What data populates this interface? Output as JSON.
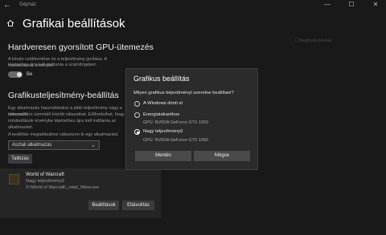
{
  "app": {
    "name": "Gépház"
  },
  "window_controls": {
    "minimize": "—",
    "maximize": "☐",
    "close": "✕"
  },
  "page": {
    "title": "Grafikai beállítások"
  },
  "hardware": {
    "title": "Hardveresen gyorsított GPU-ütemezés",
    "desc_line1": "A késés csökkentése és a teljesítmény javítása. A módosítások érvénybe",
    "desc_line2": "lépéséhez újra kell indítania a számítógépet.",
    "toggle_label": "Be",
    "toggle_on": true
  },
  "perf": {
    "title": "Grafikusteljesítmény-beállítás",
    "desc_line1": "Egy alkalmazás használatakor a jobb teljesítmény vagy a hosszabb",
    "desc_line2": "akkumulátor-üzemidő között választhat. Előfordulhat, hogy",
    "desc_line3": "módosítások érvénybe lépéséhez újra kell indítania az alkalmazást.",
    "select_label": "A beállítás megadásához válasszon ki egy alkalmazást.",
    "select_value": "Asztali alkalmazás",
    "browse_label": "Tallózás"
  },
  "app_entry": {
    "name": "World of Warcraft",
    "mode": "Nagy teljesítményű",
    "path": "D:\\World of Warcraft\\_retail_\\Wow.exe",
    "options_label": "Beállítások",
    "remove_label": "Eltávolítás"
  },
  "side_hint": {
    "text": "Segítség kérése"
  },
  "dialog": {
    "title": "Grafikus beállítás",
    "question": "Milyen grafikus teljesítményt szeretne beállítani?",
    "options": [
      {
        "label": "A Windows dönti el",
        "gpu": "",
        "selected": false
      },
      {
        "label": "Energiatakarékos",
        "gpu": "GPU: NVIDIA GeForce GTX 1650",
        "selected": false
      },
      {
        "label": "Nagy teljesítményű",
        "gpu": "GPU: NVIDIA GeForce GTX 1650",
        "selected": true
      }
    ],
    "save_label": "Mentés",
    "cancel_label": "Mégse"
  }
}
